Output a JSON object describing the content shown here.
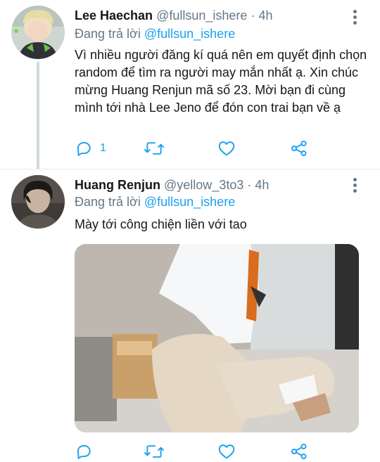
{
  "tweets": [
    {
      "name": "Lee Haechan",
      "handle": "@fullsun_ishere",
      "separator": "·",
      "time": "4h",
      "reply_prefix": "Đang trả lời",
      "reply_handle": "@fullsun_ishere",
      "text": "Vì nhiều người đăng kí quá nên em quyết định chọn random để tìm ra người may mắn nhất ạ. Xin chúc mừng Huang Renjun mã số 23. Mời bạn đi cùng mình tới nhà Lee Jeno để đón con trai bạn về ạ",
      "reply_count": "1",
      "avatar_icon": "profile-photo"
    },
    {
      "name": "Huang Renjun",
      "handle": "@yellow_3to3",
      "separator": "·",
      "time": "4h",
      "reply_prefix": "Đang trả lời",
      "reply_handle": "@fullsun_ishere",
      "text": "Mày tới công chiện liền với tao",
      "reply_count": "",
      "avatar_icon": "profile-photo",
      "media": "attached-photo"
    }
  ],
  "icons": {
    "reply": "reply-icon",
    "retweet": "retweet-icon",
    "like": "heart-icon",
    "share": "share-icon",
    "more": "more-options-icon"
  },
  "colors": {
    "accent": "#1da1f2",
    "muted": "#657786",
    "text": "#14171a",
    "divider": "#e6ecf0"
  }
}
